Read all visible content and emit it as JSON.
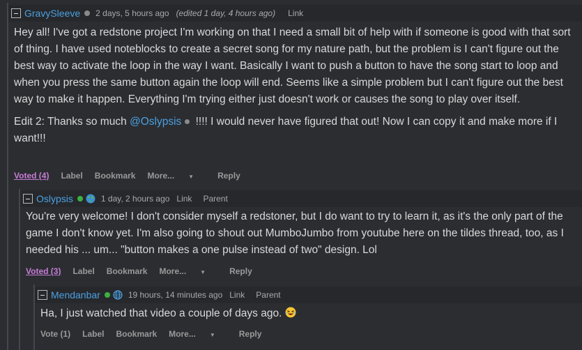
{
  "comments": [
    {
      "user": "GravySleeve",
      "time": "2 days, 5 hours ago",
      "edited": "(edited 1 day, 4 hours ago)",
      "link": "Link",
      "para1": "Hey all! I've got a redstone project I'm working on that I need a small bit of help with if someone is good with that sort of thing. I have used noteblocks to create a secret song for my nature path, but the problem is I can't figure out the best way to activate the loop in the way I want. Basically I want to push a button to have the song start to loop and when you press the same button again the loop will end. Seems like a simple problem but I can't figure out the best way to make it happen. Everything I'm trying either just doesn't work or causes the song to play over itself.",
      "edit_prefix": "Edit 2: Thanks so much ",
      "mention": "@Oslypsis",
      "edit_suffix": " !!!! I would never have figured that out! Now I can copy it and make more if I want!!!",
      "vote": "Voted (4)",
      "label": "Label",
      "bookmark": "Bookmark",
      "more": "More...",
      "reply": "Reply"
    },
    {
      "user": "Oslypsis",
      "time": "1 day, 2 hours ago",
      "link": "Link",
      "parent": "Parent",
      "text": "You're very welcome! I don't consider myself a redstoner, but I do want to try to learn it, as it's the only part of the game I don't know yet. I'm also going to shout out MumboJumbo from youtube here on the tildes thread, too, as I needed his ... um... \"button makes a one pulse instead of two\" design. Lol",
      "vote": "Voted (3)",
      "label": "Label",
      "bookmark": "Bookmark",
      "more": "More...",
      "reply": "Reply"
    },
    {
      "user": "Mendanbar",
      "time": "19 hours, 14 minutes ago",
      "link": "Link",
      "parent": "Parent",
      "text": "Ha, I just watched that video a couple of days ago.",
      "vote": "Vote (1)",
      "label": "Label",
      "bookmark": "Bookmark",
      "more": "More...",
      "reply": "Reply"
    }
  ],
  "icons": {
    "collapse": "collapse-icon",
    "globe": "globe-icon",
    "emoji": "laughing-tears-emoji"
  },
  "colors": {
    "background": "#2b2d31",
    "username": "#4ca0e0",
    "voted": "#c77dd6",
    "online": "#3cb043"
  }
}
